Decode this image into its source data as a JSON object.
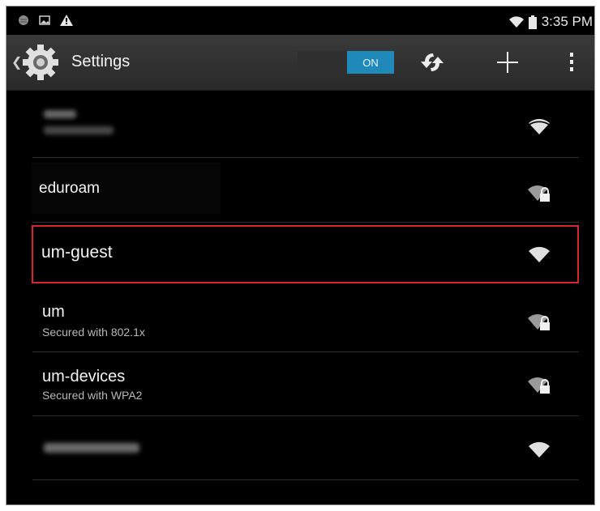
{
  "status_bar": {
    "time": "3:35 PM",
    "left_icons": [
      "globe-icon",
      "image-icon",
      "warning-icon"
    ],
    "right_icons": [
      "wifi-icon",
      "battery-icon"
    ]
  },
  "action_bar": {
    "title": "Settings",
    "toggle_label": "ON",
    "toggle_color": "#1f8ab9",
    "icons": [
      "gear-icon",
      "wps-icon",
      "add-icon",
      "overflow-menu-icon"
    ]
  },
  "networks": [
    {
      "name": "",
      "subtitle": "",
      "obscured": true,
      "secured": false
    },
    {
      "name": "eduroam",
      "subtitle": "",
      "obscured": false,
      "secured": true
    },
    {
      "name": "um-guest",
      "subtitle": "",
      "obscured": false,
      "secured": false,
      "highlighted": true
    },
    {
      "name": "um",
      "subtitle": "Secured with 802.1x",
      "obscured": false,
      "secured": true
    },
    {
      "name": "um-devices",
      "subtitle": "Secured with WPA2",
      "obscured": false,
      "secured": true
    },
    {
      "name": "",
      "subtitle": "",
      "obscured": true,
      "secured": false
    }
  ],
  "highlight_color": "#d9262c"
}
